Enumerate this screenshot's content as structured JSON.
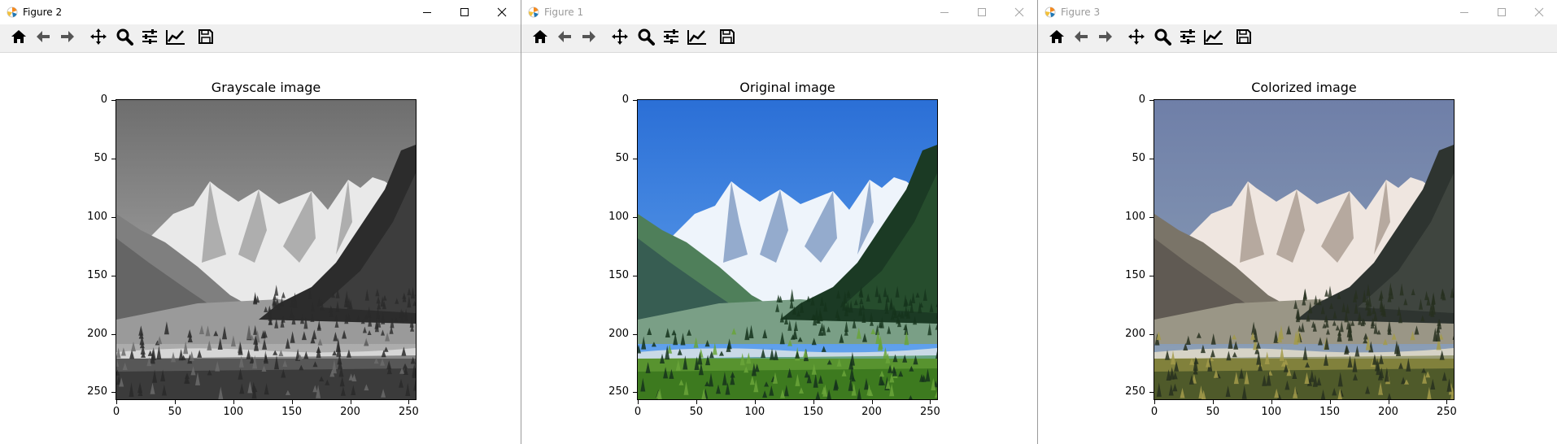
{
  "windows": [
    {
      "title": "Figure 2",
      "active": true,
      "plot_title": "Grayscale image",
      "mode": "gray"
    },
    {
      "title": "Figure 1",
      "active": false,
      "plot_title": "Original image",
      "mode": "color"
    },
    {
      "title": "Figure 3",
      "active": false,
      "plot_title": "Colorized image",
      "mode": "colorized"
    }
  ],
  "toolbar": {
    "tools": [
      "home-icon",
      "back-arrow-icon",
      "forward-arrow-icon",
      "pan-icon",
      "zoom-icon",
      "configure-subplots-icon",
      "edit-axis-icon",
      "save-icon"
    ]
  },
  "axes": {
    "yticks": [
      "0",
      "50",
      "100",
      "150",
      "200",
      "250"
    ],
    "xticks": [
      "0",
      "50",
      "100",
      "150",
      "200",
      "250"
    ],
    "ytick_values": [
      0,
      50,
      100,
      150,
      200,
      250
    ],
    "xtick_values": [
      0,
      50,
      100,
      150,
      200,
      250
    ],
    "range": [
      0,
      256
    ]
  },
  "colors": {
    "sky_color": "#2f7fe6",
    "sky_gray": "#8a8a8a",
    "sky_colorized": "#7d8fb8"
  }
}
